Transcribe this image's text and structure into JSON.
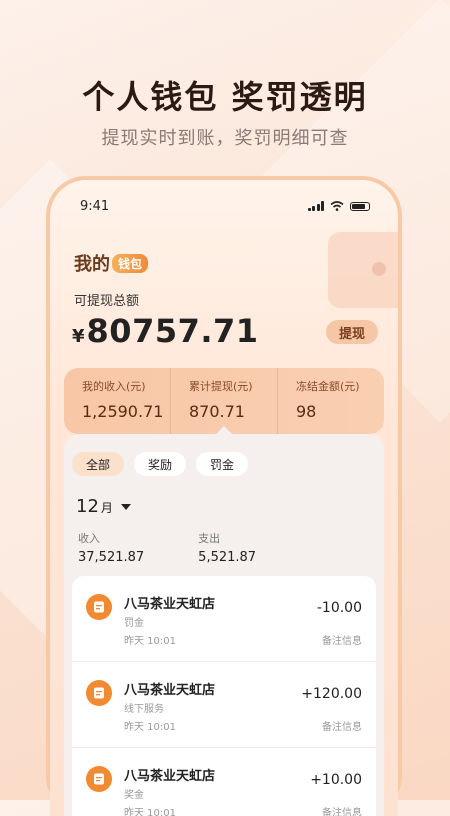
{
  "promo": {
    "headline": "个人钱包  奖罚透明",
    "subline": "提现实时到账，奖罚明细可查"
  },
  "status_bar": {
    "time": "9:41"
  },
  "wallet": {
    "title_main": "我的",
    "title_tag": "钱包",
    "balance_label": "可提现总额",
    "currency": "¥",
    "balance": "80757.71",
    "withdraw_label": "提现"
  },
  "stats": [
    {
      "label": "我的收入(元)",
      "value": "1,2590.71"
    },
    {
      "label": "累计提现(元)",
      "value": "870.71"
    },
    {
      "label": "冻结金额(元)",
      "value": "98"
    }
  ],
  "filters": [
    {
      "label": "全部",
      "active": true
    },
    {
      "label": "奖励",
      "active": false
    },
    {
      "label": "罚金",
      "active": false
    }
  ],
  "month": {
    "number": "12",
    "unit": "月"
  },
  "summary": {
    "income_label": "收入",
    "income_value": "37,521.87",
    "expense_label": "支出",
    "expense_value": "5,521.87"
  },
  "records": [
    {
      "title": "八马茶业天虹店",
      "type": "罚金",
      "time": "昨天 10:01",
      "amount": "-10.00",
      "note": "备注信息"
    },
    {
      "title": "八马茶业天虹店",
      "type": "线下服务",
      "time": "昨天 10:01",
      "amount": "+120.00",
      "note": "备注信息"
    },
    {
      "title": "八马茶业天虹店",
      "type": "奖金",
      "time": "昨天 10:01",
      "amount": "+10.00",
      "note": "备注信息"
    }
  ],
  "colors": {
    "accent": "#f28a32",
    "stats_bg": "#f8c7a6",
    "brand_brown": "#6b3b1e"
  },
  "icons": {
    "record": "document-icon",
    "dropdown": "caret-down-icon"
  }
}
